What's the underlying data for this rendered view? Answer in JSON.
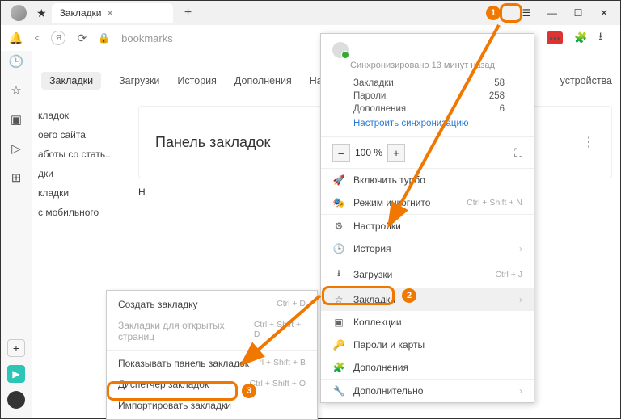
{
  "tabbar": {
    "title": "Закладки"
  },
  "address": {
    "url": "bookmarks",
    "pagetitle": "Закладки"
  },
  "navtabs": [
    "Закладки",
    "Загрузки",
    "История",
    "Дополнения",
    "Настройки",
    "устройства"
  ],
  "sidepanel": [
    "кладок",
    "оего сайта",
    "аботы со стать...",
    "дки",
    "кладки",
    "с мобильного"
  ],
  "card": {
    "title": "Панель закладок"
  },
  "rowletter": "Н",
  "ctx": {
    "create": "Создать закладку",
    "create_sc": "Ctrl + D",
    "open": "Закладки для открытых страниц",
    "open_sc": "Ctrl + Shift + D",
    "show": "Показывать панель закладок",
    "show_sc": "rl + Shift + B",
    "mgr": "Диспетчер закладок",
    "mgr_sc": "Ctrl + Shift + O",
    "import": "Импортировать закладки"
  },
  "menu": {
    "synctext": "Синхронизировано 13 минут назад",
    "stats": {
      "bookmarks_l": "Закладки",
      "bookmarks_v": "58",
      "passwords_l": "Пароли",
      "passwords_v": "258",
      "addons_l": "Дополнения",
      "addons_v": "6"
    },
    "synclink": "Настроить синхронизацию",
    "zoom": "100 %",
    "items": {
      "turbo": "Включить турбо",
      "incog": "Режим инкогнито",
      "incog_sc": "Ctrl + Shift + N",
      "settings": "Настройки",
      "history": "История",
      "downloads": "Загрузки",
      "downloads_sc": "Ctrl + J",
      "bookmarks": "Закладки",
      "collections": "Коллекции",
      "passwords": "Пароли и карты",
      "addons": "Дополнения",
      "more": "Дополнительно"
    }
  }
}
